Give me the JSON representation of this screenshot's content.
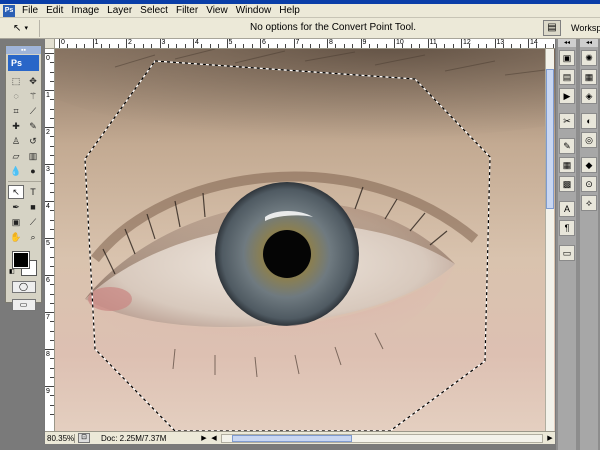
{
  "menu": {
    "app_icon": "Ps",
    "items": [
      "File",
      "Edit",
      "Image",
      "Layer",
      "Select",
      "Filter",
      "View",
      "Window",
      "Help"
    ]
  },
  "options": {
    "tool_icon": "convert-point-arrow-icon",
    "message": "No options for the Convert Point Tool.",
    "workspace_label": "Workspac"
  },
  "toolbox": {
    "logo": "Ps",
    "tools": [
      "marquee-icon",
      "move-icon",
      "lasso-icon",
      "magic-wand-icon",
      "crop-icon",
      "slice-icon",
      "healing-brush-icon",
      "brush-icon",
      "clone-stamp-icon",
      "history-brush-icon",
      "eraser-icon",
      "gradient-icon",
      "blur-icon",
      "dodge-icon",
      "path-selection-icon",
      "type-icon",
      "pen-icon",
      "shape-icon",
      "notes-icon",
      "eyedropper-icon",
      "hand-icon",
      "zoom-icon"
    ],
    "colors": {
      "foreground": "#000000",
      "background": "#ffffff"
    }
  },
  "rulers": {
    "h_labels": [
      "0",
      "1",
      "2",
      "3",
      "4",
      "5",
      "6",
      "7",
      "8",
      "9",
      "10",
      "11",
      "12",
      "13",
      "14"
    ],
    "v_labels": [
      "0",
      "1",
      "2",
      "3",
      "4",
      "5",
      "6",
      "7",
      "8",
      "9"
    ]
  },
  "status": {
    "zoom": "80.35%",
    "doc_info": "Doc: 2.25M/7.37M"
  },
  "colors": {
    "menu_bg": "#ece9d8",
    "workspace_bg": "#7a7a7a",
    "accent": "#2966c8"
  }
}
